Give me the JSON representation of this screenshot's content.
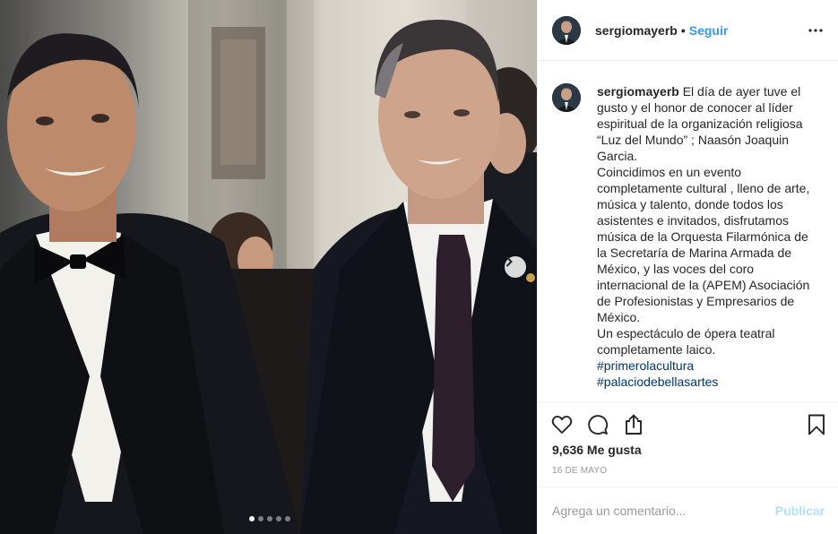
{
  "post": {
    "username": "sergiomayerb",
    "bullet": "•",
    "follow_label": "Seguir",
    "more_icon": "more-horizontal-icon",
    "media": {
      "description_icon": "photo",
      "next_icon": "chevron-right-icon",
      "slides_total": 5,
      "active_slide": 1
    },
    "caption": {
      "lines": [
        "El día de ayer tuve el",
        "gusto y el honor de conocer al líder",
        "espiritual de la organización religiosa",
        "“Luz del Mundo” ; Naasón Joaquin",
        "Garcia.",
        "Coincidimos en un evento",
        "completamente cultural , lleno de arte,",
        "música y talento, donde todos los",
        "asistentes e invitados, disfrutamos",
        "música de la Orquesta Filarmónica de",
        "la Secretaría de Marina Armada de",
        "México, y las voces del coro",
        "internacional de la (APEM) Asociación",
        "de Profesionistas y Empresarios de",
        "México.",
        "Un espectáculo de ópera teatral",
        "completamente laico."
      ],
      "hashtags": [
        "#primerolacultura",
        "#palaciodebellasartes"
      ]
    },
    "actions": {
      "like_icon": "heart-icon",
      "comment_icon": "comment-icon",
      "share_icon": "share-icon",
      "save_icon": "bookmark-icon"
    },
    "likes": "9,636 Me gusta",
    "date": "16 DE MAYO",
    "comment": {
      "placeholder": "Agrega un comentario...",
      "value": "",
      "publish_label": "Publicar"
    },
    "colors": {
      "link": "#3897f0",
      "hashtag": "#003569",
      "publish_disabled": "#b2dffc",
      "muted": "#999999"
    }
  }
}
